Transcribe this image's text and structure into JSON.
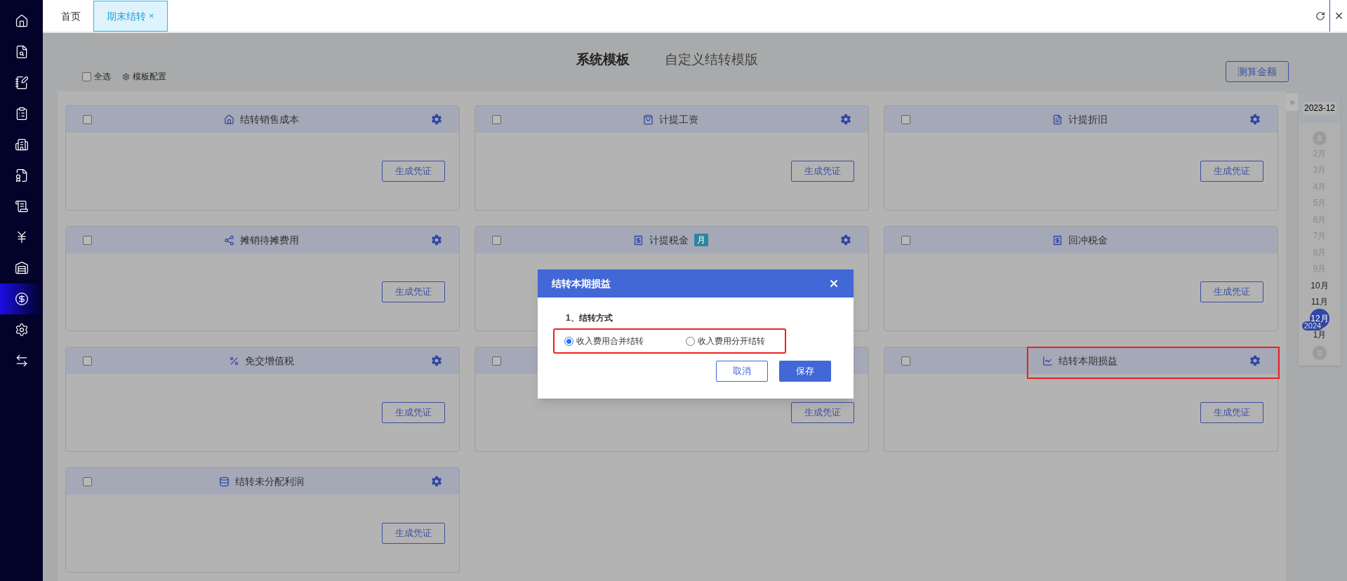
{
  "sidebar": {
    "items": [
      {
        "selected": false
      },
      {
        "selected": false
      },
      {
        "selected": false
      },
      {
        "selected": false
      },
      {
        "selected": false
      },
      {
        "selected": false
      },
      {
        "selected": false
      },
      {
        "selected": false
      },
      {
        "selected": false
      },
      {
        "selected": true
      },
      {
        "selected": false
      },
      {
        "selected": false
      }
    ]
  },
  "tabs": [
    {
      "label": "首页",
      "selected": false
    },
    {
      "label": "期末结转",
      "selected": true,
      "close": "×"
    }
  ],
  "toolbar": {
    "select_all": {
      "label": "全选",
      "checked": false
    },
    "config": "模板配置",
    "template_tabs": [
      {
        "label": "系统模板",
        "selected": true
      },
      {
        "label": "自定义结转模版",
        "selected": false
      }
    ],
    "calc_button": "测算金额"
  },
  "cards": [
    {
      "title": "结转销售成本",
      "checked": false,
      "settings": true,
      "button": "生成凭证",
      "highlighted": false
    },
    {
      "title": "计提工资",
      "checked": false,
      "settings": true,
      "button": "生成凭证",
      "highlighted": false
    },
    {
      "title": "计提折旧",
      "checked": false,
      "settings": true,
      "button": "生成凭证",
      "highlighted": false
    },
    {
      "title": "摊销待摊费用",
      "checked": false,
      "settings": true,
      "button": "生成凭证",
      "highlighted": false
    },
    {
      "title": "计提税金",
      "checked": false,
      "badge": "月",
      "settings": true,
      "highlighted": false
    },
    {
      "title": "回冲税金",
      "checked": false,
      "settings": false,
      "button": "生成凭证",
      "highlighted": false
    },
    {
      "title": "免交增值税",
      "checked": false,
      "settings": true,
      "button": "生成凭证",
      "highlighted": false
    },
    {
      "checked": false,
      "settings": false,
      "button": "生成凭证",
      "highlighted": false
    },
    {
      "title": "结转本期损益",
      "checked": false,
      "settings": true,
      "button": "生成凭证",
      "highlighted": true
    },
    {
      "title": "结转未分配利润",
      "checked": false,
      "settings": true,
      "button": "生成凭证",
      "highlighted": false
    }
  ],
  "period_panel": {
    "expand": "»",
    "current": "2023-12",
    "months": [
      {
        "label": "2月",
        "disabled": true,
        "selected": false
      },
      {
        "label": "3月",
        "disabled": true,
        "selected": false
      },
      {
        "label": "4月",
        "disabled": true,
        "selected": false
      },
      {
        "label": "5月",
        "disabled": true,
        "selected": false
      },
      {
        "label": "6月",
        "disabled": true,
        "selected": false
      },
      {
        "label": "7月",
        "disabled": true,
        "selected": false
      },
      {
        "label": "8月",
        "disabled": true,
        "selected": false
      },
      {
        "label": "9月",
        "disabled": true,
        "selected": false
      },
      {
        "label": "10月",
        "disabled": false,
        "selected": false
      },
      {
        "label": "11月",
        "disabled": false,
        "selected": false
      },
      {
        "label": "12月",
        "disabled": false,
        "selected": true
      },
      {
        "label": "1月",
        "disabled": false,
        "selected": false,
        "year_badge": "2024"
      }
    ]
  },
  "modal": {
    "title": "结转本期损益",
    "section": "1、结转方式",
    "options_highlighted": true,
    "options": [
      {
        "label": "收入费用合并结转",
        "selected": true
      },
      {
        "label": "收入费用分开结转",
        "selected": false
      }
    ],
    "buttons": [
      {
        "label": "取消",
        "kind": "secondary"
      },
      {
        "label": "保存",
        "kind": "primary"
      }
    ]
  }
}
